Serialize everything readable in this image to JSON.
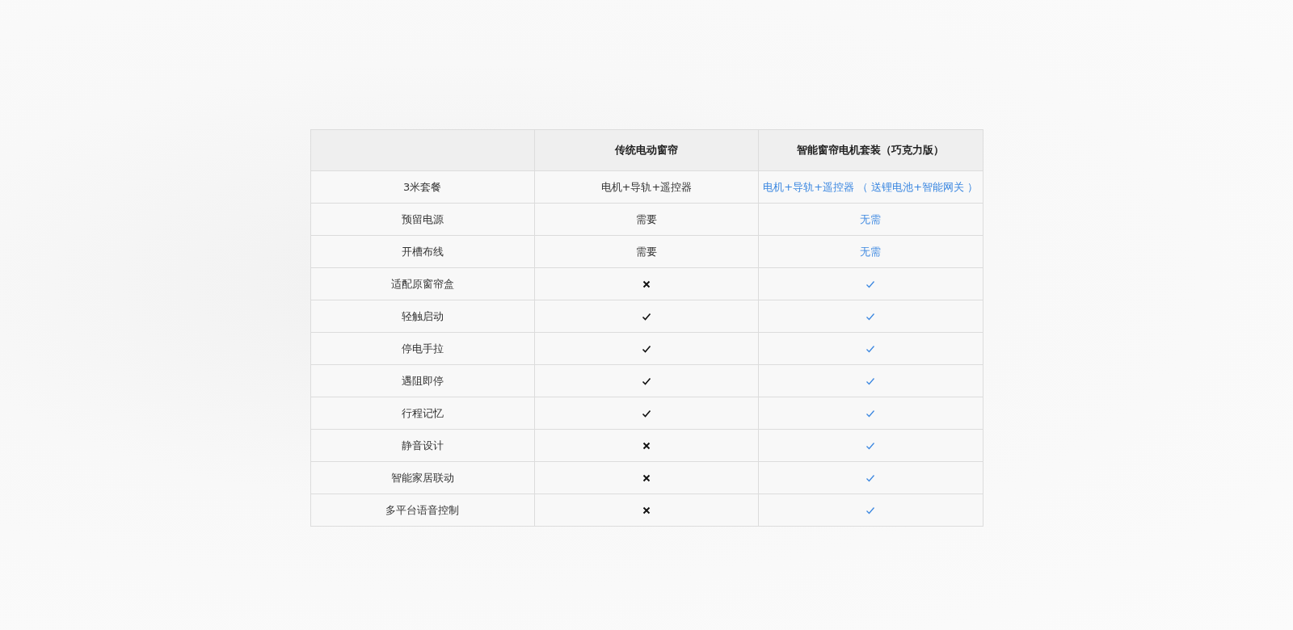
{
  "table": {
    "columns": [
      {},
      {
        "label": "传统电动窗帘"
      },
      {
        "label": "智能窗帘电机套装（巧克力版）"
      }
    ],
    "rows": [
      {
        "cells": [
          {
            "kind": "text",
            "text": "3米套餐",
            "highlighted": false
          },
          {
            "kind": "text",
            "text": "电机+导轨+遥控器",
            "highlighted": false
          },
          {
            "kind": "text",
            "text": "电机+导轨+遥控器 （ 送锂电池+智能网关 ）",
            "highlighted": true
          }
        ]
      },
      {
        "cells": [
          {
            "kind": "text",
            "text": "预留电源",
            "highlighted": false
          },
          {
            "kind": "text",
            "text": "需要",
            "highlighted": false
          },
          {
            "kind": "text",
            "text": "无需",
            "highlighted": true
          }
        ]
      },
      {
        "cells": [
          {
            "kind": "text",
            "text": "开槽布线",
            "highlighted": false
          },
          {
            "kind": "text",
            "text": "需要",
            "highlighted": false
          },
          {
            "kind": "text",
            "text": "无需",
            "highlighted": true
          }
        ]
      },
      {
        "cells": [
          {
            "kind": "text",
            "text": "适配原窗帘盒",
            "highlighted": false
          },
          {
            "kind": "mark",
            "supported": false,
            "highlighted": false
          },
          {
            "kind": "mark",
            "supported": true,
            "highlighted": true
          }
        ]
      },
      {
        "cells": [
          {
            "kind": "text",
            "text": "轻触启动",
            "highlighted": false
          },
          {
            "kind": "mark",
            "supported": true,
            "highlighted": false
          },
          {
            "kind": "mark",
            "supported": true,
            "highlighted": true
          }
        ]
      },
      {
        "cells": [
          {
            "kind": "text",
            "text": "停电手拉",
            "highlighted": false
          },
          {
            "kind": "mark",
            "supported": true,
            "highlighted": false
          },
          {
            "kind": "mark",
            "supported": true,
            "highlighted": true
          }
        ]
      },
      {
        "cells": [
          {
            "kind": "text",
            "text": "遇阻即停",
            "highlighted": false
          },
          {
            "kind": "mark",
            "supported": true,
            "highlighted": false
          },
          {
            "kind": "mark",
            "supported": true,
            "highlighted": true
          }
        ]
      },
      {
        "cells": [
          {
            "kind": "text",
            "text": "行程记忆",
            "highlighted": false
          },
          {
            "kind": "mark",
            "supported": true,
            "highlighted": false
          },
          {
            "kind": "mark",
            "supported": true,
            "highlighted": true
          }
        ]
      },
      {
        "cells": [
          {
            "kind": "text",
            "text": "静音设计",
            "highlighted": false
          },
          {
            "kind": "mark",
            "supported": false,
            "highlighted": false
          },
          {
            "kind": "mark",
            "supported": true,
            "highlighted": true
          }
        ]
      },
      {
        "cells": [
          {
            "kind": "text",
            "text": "智能家居联动",
            "highlighted": false
          },
          {
            "kind": "mark",
            "supported": false,
            "highlighted": false
          },
          {
            "kind": "mark",
            "supported": true,
            "highlighted": true
          }
        ]
      },
      {
        "cells": [
          {
            "kind": "text",
            "text": "多平台语音控制",
            "highlighted": false
          },
          {
            "kind": "mark",
            "supported": false,
            "highlighted": false
          },
          {
            "kind": "mark",
            "supported": true,
            "highlighted": true
          }
        ]
      }
    ]
  }
}
